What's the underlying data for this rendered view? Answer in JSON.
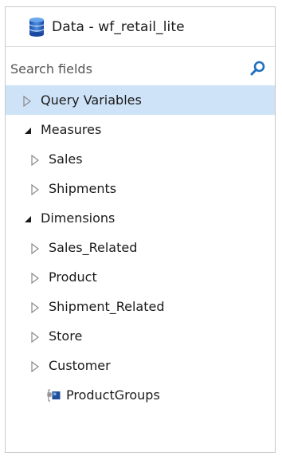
{
  "panel": {
    "title": "Data - wf_retail_lite",
    "title_icon": "database-icon"
  },
  "search": {
    "placeholder": "Search fields",
    "icon": "search-icon",
    "accent": "#1f6fbf"
  },
  "tree": {
    "selected_bg": "#cfe3f8",
    "query_variables": "Query Variables",
    "measures": "Measures",
    "sales": "Sales",
    "shipments": "Shipments",
    "dimensions": "Dimensions",
    "sales_related": "Sales_Related",
    "product": "Product",
    "shipment_related": "Shipment_Related",
    "store": "Store",
    "customer": "Customer",
    "product_groups": "ProductGroups"
  }
}
